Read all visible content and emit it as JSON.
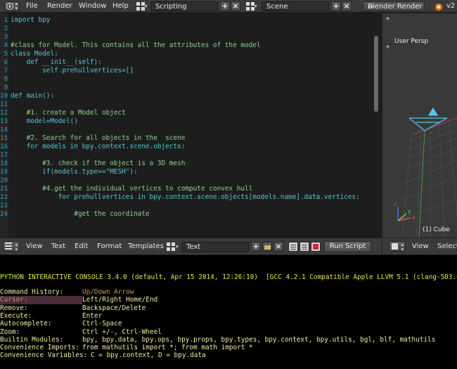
{
  "topbar": {
    "menus": [
      "File",
      "Render",
      "Window",
      "Help"
    ],
    "screen_layout": "Scripting",
    "scene": "Scene",
    "renderer": "Blender Render",
    "version": "v2"
  },
  "editor": {
    "lines": [
      {
        "n": "1",
        "text": "import bpy"
      },
      {
        "n": "2",
        "text": ""
      },
      {
        "n": "3",
        "text": ""
      },
      {
        "n": "4",
        "text": "#class for Model. This contains all the attributes of the model"
      },
      {
        "n": "5",
        "text": "class Model:"
      },
      {
        "n": "6",
        "text": "    def __init__(self):"
      },
      {
        "n": "7",
        "text": "        self.prehullvertices=[]"
      },
      {
        "n": "8",
        "text": ""
      },
      {
        "n": "9",
        "text": ""
      },
      {
        "n": "10",
        "text": "def main():"
      },
      {
        "n": "11",
        "text": ""
      },
      {
        "n": "12",
        "text": "    #1. create a Model object"
      },
      {
        "n": "13",
        "text": "    model=Model()"
      },
      {
        "n": "14",
        "text": ""
      },
      {
        "n": "15",
        "text": "    #2. Search for all objects in the  scene"
      },
      {
        "n": "16",
        "text": "    for models in bpy.context.scene.objects:"
      },
      {
        "n": "17",
        "text": ""
      },
      {
        "n": "18",
        "text": "        #3. check if the object is a 3D mesh"
      },
      {
        "n": "19",
        "text": "        if(models.type==\"MESH\"):"
      },
      {
        "n": "20",
        "text": ""
      },
      {
        "n": "21",
        "text": "        #4.get the individual vertices to compute convex hull"
      },
      {
        "n": "22",
        "text": "            for prehullvertices in bpy.context.scene.objects[models.name].data.vertices:"
      },
      {
        "n": "23",
        "text": ""
      },
      {
        "n": "24",
        "text": "                #get the coordinate"
      }
    ]
  },
  "editor_bar": {
    "menus": [
      "View",
      "Text",
      "Edit",
      "Format",
      "Templates"
    ],
    "text_name": "Text",
    "run_label": "Run Script",
    "vp_menus": [
      "View",
      "Select"
    ]
  },
  "viewport": {
    "persp_label": "User Persp",
    "object_label": "(1) Cube"
  },
  "console": {
    "header": "PYTHON INTERACTIVE CONSOLE 3.4.0 (default, Apr 15 2014, 12:26:10)  [GCC 4.2.1 Compatible Apple LLVM 5.1 (clang-503.0",
    "rows": [
      {
        "k": "Command History:",
        "v": "Up/Down Arrow"
      },
      {
        "k": "Cursor:",
        "v": "Left/Right Home/End"
      },
      {
        "k": "Remove:",
        "v": "Backspace/Delete"
      },
      {
        "k": "Execute:",
        "v": "Enter"
      },
      {
        "k": "Autocomplete:",
        "v": "Ctrl-Space"
      },
      {
        "k": "Zoom:",
        "v": "Ctrl +/-, Ctrl-Wheel"
      },
      {
        "k": "Builtin Modules:",
        "v": "bpy, bpy.data, bpy.ops, bpy.props, bpy.types, bpy.context, bpy.utils, bgl, blf, mathutils"
      },
      {
        "k": "Convenience Imports:",
        "v": "from mathutils import *; from math import *"
      },
      {
        "k": "Convenience Variables:",
        "v": "C = bpy.context, D = bpy.data"
      }
    ]
  }
}
